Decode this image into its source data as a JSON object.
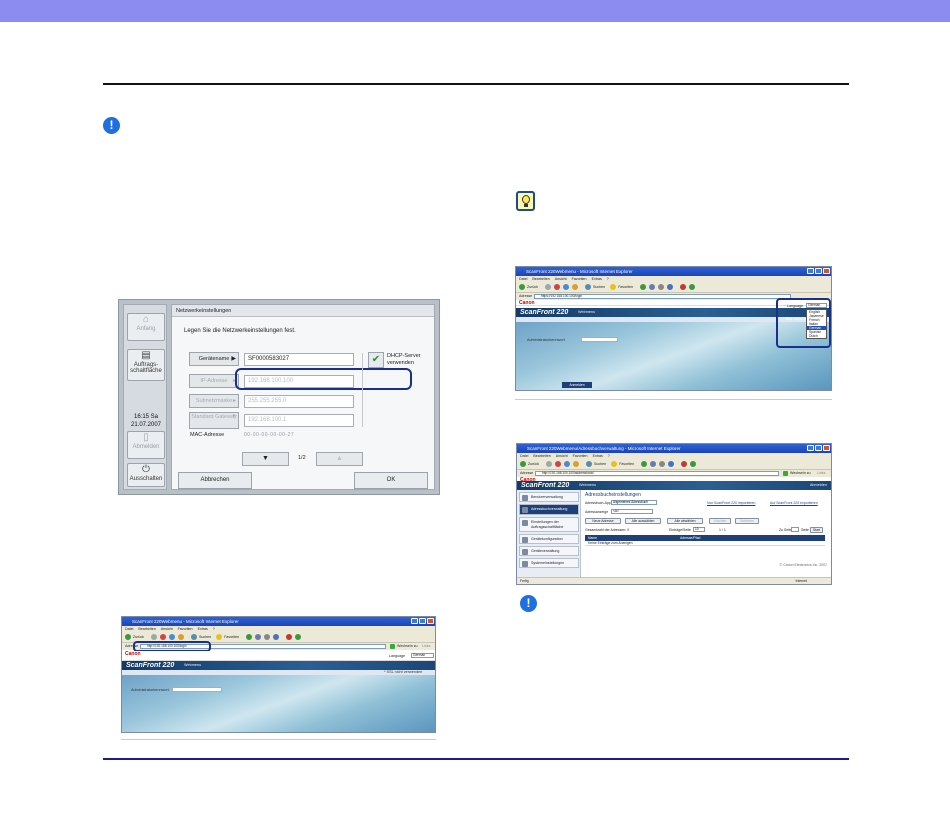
{
  "touch_panel": {
    "title": "Netzwerkeinstellungen",
    "instruction": "Legen Sie die Netzwerkeinstellungen fest.",
    "side_buttons": [
      {
        "label": "Anfang",
        "icon": "home-icon"
      },
      {
        "label": "Auftrags-schaltfläche",
        "icon": "job-button-icon"
      },
      {
        "label": "Abmelden",
        "icon": "logout-icon"
      },
      {
        "label": "Ausschalten",
        "icon": "power-icon"
      }
    ],
    "time": "16:15 Sa",
    "date": "21.07.2007",
    "rows": [
      {
        "label": "Gerätename",
        "value": "SF0000583027"
      },
      {
        "label": "IP-Adresse",
        "value": "192.168.100.100"
      },
      {
        "label": "Subnetzmaske",
        "value": "255.255.255.0"
      },
      {
        "label": "Standard Gateway",
        "value": "192.168.100.1"
      }
    ],
    "dhcp_label": "DHCP-Server verwenden",
    "mac_label": "MAC-Adresse",
    "mac_value": "00-00-00-00-00-27",
    "page_down": "▼",
    "page_up": "▲",
    "page_indicator": "1/2",
    "cancel_label": "Abbrechen",
    "ok_label": "OK"
  },
  "browser_common": {
    "menu": [
      "Datei",
      "Bearbeiten",
      "Ansicht",
      "Favoriten",
      "Extras",
      "?"
    ],
    "back": "Zurück",
    "search": "Suchen",
    "favorites": "Favoriten",
    "address_label": "Adresse",
    "go_label": "Wechseln zu",
    "links_label": "Links",
    "canon": "Canon",
    "product": "ScanFront 220",
    "web_menu": "Webmenu",
    "language_label": "Language",
    "language_value": "German",
    "ssl_label": "* SSL nicht verwenden",
    "admin_pw_label": "Administratorkennwort",
    "login": "Anmelden",
    "status_done": "Fertig",
    "status_zone": "Internet"
  },
  "browser_login_top": {
    "title": "ScanFront 220Webmenu - Microsoft Internet Explorer",
    "url": "https://192.168.100.100/login"
  },
  "language_list": [
    "English",
    "Japanese",
    "French",
    "Italian",
    "German",
    "Spanish",
    "Dutch"
  ],
  "browser_login_bottom": {
    "title": "ScanFront 220Webmenu - Microsoft Internet Explorer",
    "url": "http://192.168.100.100/login"
  },
  "browser_address": {
    "title": "ScanFront 220Webmenu/Adressbuchverwaltung - Microsoft Internet Explorer",
    "url": "http://192.168.100.100/addressbook/",
    "logout": "Abmelden",
    "sidebar": [
      "Benutzerverwaltung",
      "Adressbuchverwaltung",
      "Einstellungen der Auftragsschaltfläche",
      "Gerätekonfiguration",
      "Geräteverwaltung",
      "Systemeinstellungen"
    ],
    "heading": "Adressbucheinstellungen",
    "ab_app_label": "Adressbuch-App",
    "ab_app_value": "Allgemeines Adressbuch",
    "import_link": "Von ScanFront 220 importieren",
    "export_link": "Auf ScanFront 220 exportieren",
    "index_label": "Adressanzeige",
    "index_value": "<A>",
    "btn_new": "Neue Adresse",
    "btn_select_all": "Alle auswählen",
    "btn_deselect_all": "Alle abwählen",
    "btn_delete": "Löschen",
    "btn_sort": "Sortieren",
    "total_label": "Gesamtzahl der Adressen: 0",
    "entries_label": "Einträge/Seite",
    "entries_value": "10",
    "page_value": "1 / 1",
    "goto_label": "Zu Seite",
    "page_suffix": "Seite",
    "start_label": "Start",
    "col_name": "Name",
    "col_email": "Adresse/Pfad",
    "empty_msg": "Keine Einträge zum Anzeigen",
    "copyright": "© Canon Electronics Inc. 2007"
  }
}
